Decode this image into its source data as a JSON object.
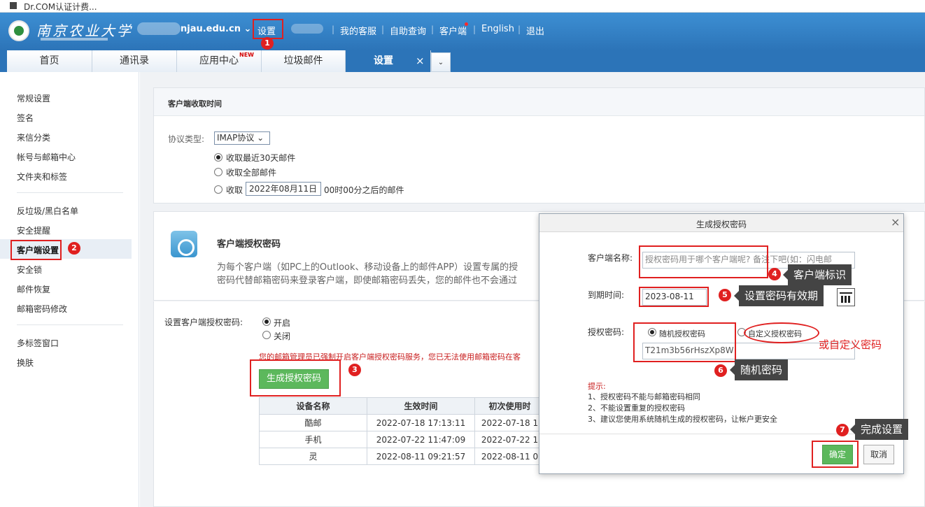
{
  "browser": {
    "title": "Dr.COM认证计费..."
  },
  "header": {
    "logo_text": "南京农业大学",
    "account": "njau.edu.cn ⌄",
    "nav": [
      "设置",
      "我的客服",
      "自助查询",
      "客户端",
      "English",
      "退出"
    ]
  },
  "tabs": [
    {
      "label": "首页"
    },
    {
      "label": "通讯录"
    },
    {
      "label": "应用中心"
    },
    {
      "label": "垃圾邮件"
    },
    {
      "label": "设置"
    }
  ],
  "tab_new_badge": "NEW",
  "tab_close": "×",
  "sidebar": {
    "group1": [
      "常规设置",
      "签名",
      "来信分类",
      "帐号与邮箱中心",
      "文件夹和标签"
    ],
    "group2": [
      "反垃圾/黑白名单",
      "安全提醒",
      "客户端设置",
      "安全锁",
      "邮件恢复",
      "邮箱密码修改"
    ],
    "group3": [
      "多标签窗口",
      "换肤"
    ]
  },
  "receive": {
    "title": "客户端收取时间",
    "protocol_label": "协议类型:",
    "protocol_value": "IMAP协议 ⌄",
    "opt1": "收取最近30天邮件",
    "opt2": "收取全部邮件",
    "opt3_prefix": "收取",
    "opt3_date": "2022年08月11日",
    "opt3_suffix": "00时00分之后的邮件"
  },
  "auth": {
    "title": "客户端授权密码",
    "desc1": "为每个客户端（如PC上的Outlook、移动设备上的邮件APP）设置专属的授",
    "desc2": "密码代替邮箱密码来登录客户端，即使邮箱密码丢失，您的邮件也不会通过",
    "setting_label": "设置客户端授权密码:",
    "on": "开启",
    "off": "关闭",
    "warning": "您的邮箱管理员已强制开启客户端授权密码服务，您已无法使用邮箱密码在客",
    "gen_button": "生成授权密码"
  },
  "devices": {
    "headers": [
      "设备名称",
      "生效时间",
      "初次使用时"
    ],
    "rows": [
      [
        "酷邮",
        "2022-07-18 17:13:11",
        "2022-07-18 1"
      ],
      [
        "手机",
        "2022-07-22 11:47:09",
        "2022-07-22 1"
      ],
      [
        "灵",
        "2022-08-11 09:21:57",
        "2022-08-11 0"
      ]
    ]
  },
  "dialog": {
    "title": "生成授权密码",
    "close": "×",
    "client_label": "客户端名称:",
    "client_placeholder": "授权密码用于哪个客户端呢? 备注下吧(如：闪电邮",
    "expiry_label": "到期时间:",
    "expiry_value": "2023-08-11",
    "pwd_label": "授权密码:",
    "random_opt": "随机授权密码",
    "custom_opt": "自定义授权密码",
    "pwd_value": "T21m3b56rHszXp8W",
    "hint_title": "提示:",
    "hints": [
      "1、授权密码不能与邮箱密码相同",
      "2、不能设置重复的授权密码",
      "3、建议您使用系统随机生成的授权密码，让帐户更安全"
    ],
    "ok": "确定",
    "cancel": "取消"
  },
  "annotations": {
    "numbers": [
      "1",
      "2",
      "3",
      "4",
      "5",
      "6",
      "7"
    ],
    "callout4": "客户端标识",
    "callout5": "设置密码有效期",
    "callout6": "随机密码",
    "callout7": "完成设置",
    "custom_note": "或自定义密码"
  },
  "colors": {
    "header_blue": "#2c74b8",
    "accent_red": "#e02020",
    "ok_green": "#5cb85c"
  }
}
